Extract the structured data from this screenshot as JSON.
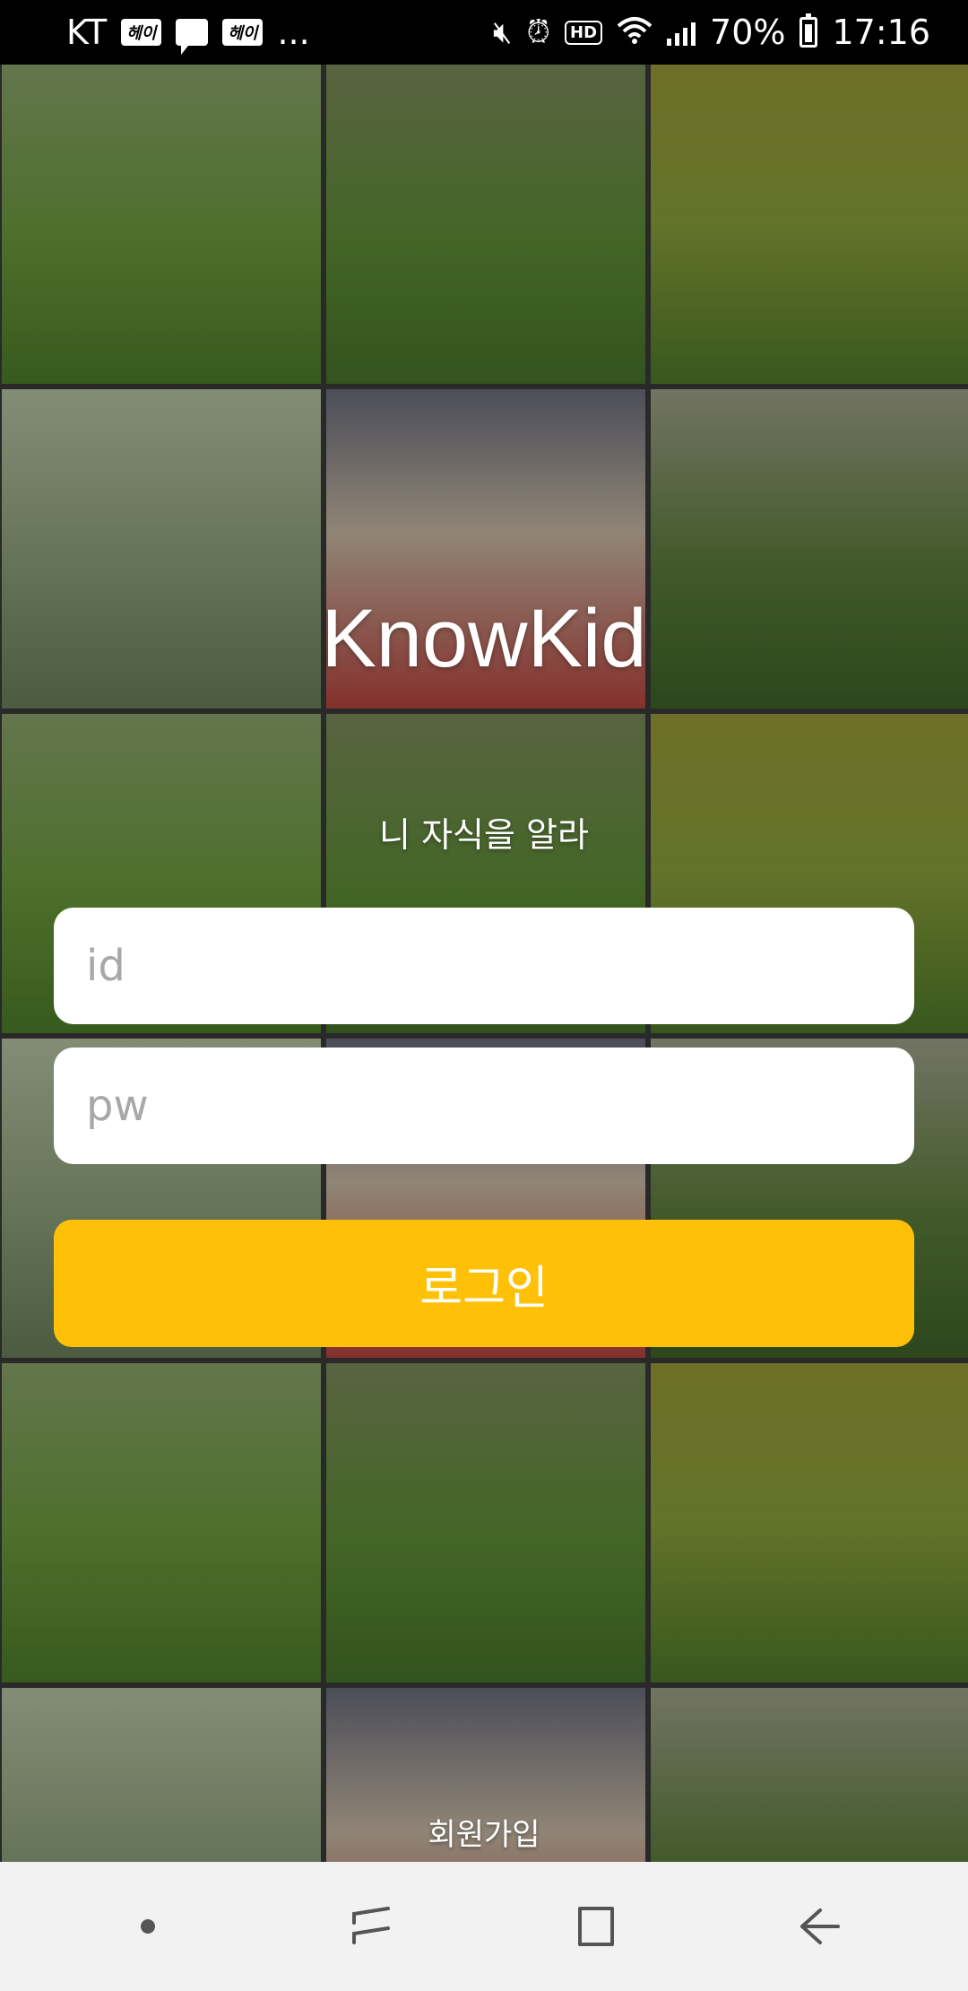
{
  "status_bar": {
    "carrier": "KT",
    "badge1": "헤이",
    "badge2": "헤이",
    "more": "...",
    "battery": "70%",
    "time": "17:16",
    "hd": "HD"
  },
  "app": {
    "title": "KnowKid",
    "subtitle": "니 자식을 알라"
  },
  "login_form": {
    "id_placeholder": "id",
    "pw_placeholder": "pw",
    "login_label": "로그인",
    "signup_label": "회원가입"
  },
  "colors": {
    "login_button": "#ffc107",
    "nav_bar": "#f2f2f2"
  },
  "nav_bar": {
    "icons": [
      "dot-icon",
      "recent-apps-icon",
      "home-icon",
      "back-icon"
    ]
  }
}
